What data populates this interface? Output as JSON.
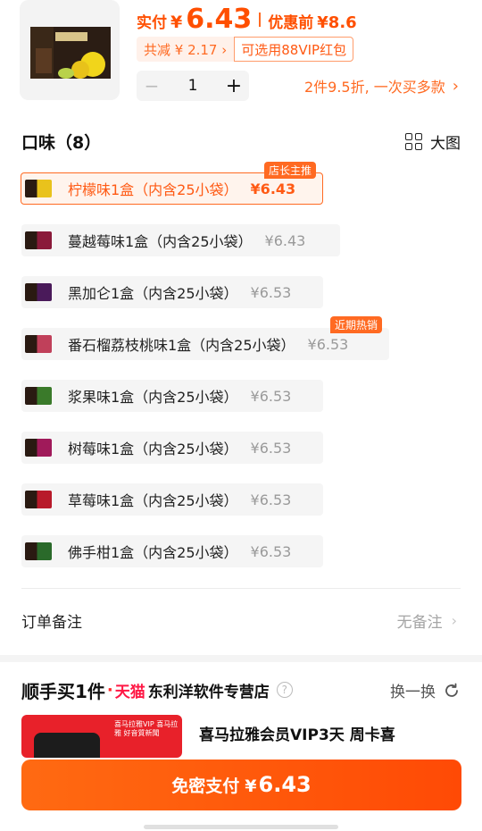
{
  "summary": {
    "actual_label": "实付",
    "currency": "¥",
    "actual_price": "6.43",
    "original_label": "优惠前",
    "original_price": "¥8.6",
    "discount_chip": "共减 ¥ 2.17 ›",
    "vip_chip": "可选用88VIP红包",
    "quantity": "1",
    "minus": "−",
    "plus": "+",
    "promo": "2件9.5折, 一次买多款",
    "promo_chevron": "›"
  },
  "flavor": {
    "title": "口味（8）",
    "view_label": "大图",
    "options": [
      {
        "label": "柠檬味1盒（内含25小袋）",
        "price": "¥6.43",
        "tag": "店长主推",
        "color": "#e9c21c"
      },
      {
        "label": "蔓越莓味1盒（内含25小袋）",
        "price": "¥6.43",
        "tag": "",
        "color": "#8a1a3a"
      },
      {
        "label": "黑加仑1盒（内含25小袋）",
        "price": "¥6.53",
        "tag": "",
        "color": "#4a1a5a"
      },
      {
        "label": "番石榴荔枝桃味1盒（内含25小袋）",
        "price": "¥6.53",
        "tag": "近期热销",
        "color": "#c0405a"
      },
      {
        "label": "浆果味1盒（内含25小袋）",
        "price": "¥6.53",
        "tag": "",
        "color": "#3a7a2a"
      },
      {
        "label": "树莓味1盒（内含25小袋）",
        "price": "¥6.53",
        "tag": "",
        "color": "#a01a5a"
      },
      {
        "label": "草莓味1盒（内含25小袋）",
        "price": "¥6.53",
        "tag": "",
        "color": "#b81a2a"
      },
      {
        "label": "佛手柑1盒（内含25小袋）",
        "price": "¥6.53",
        "tag": "",
        "color": "#2a6a2a"
      }
    ]
  },
  "remark": {
    "label": "订单备注",
    "value": "无备注",
    "chevron": "›"
  },
  "addon": {
    "title": "顺手买1件",
    "dot": "·",
    "tmall": "天猫",
    "store": "东利洋软件专营店",
    "help": "?",
    "switch_label": "换一换",
    "product_name": "喜马拉雅会员VIP3天 周卡喜",
    "thumb_text": "喜马拉雅VIP 喜马拉雅 好音質新聞"
  },
  "pay": {
    "label": "免密支付",
    "currency": "¥",
    "amount": "6.43"
  },
  "colors": {
    "accent": "#ff6a22",
    "pay_gradient_start": "#ff6a12",
    "pay_gradient_end": "#ff4a05"
  }
}
